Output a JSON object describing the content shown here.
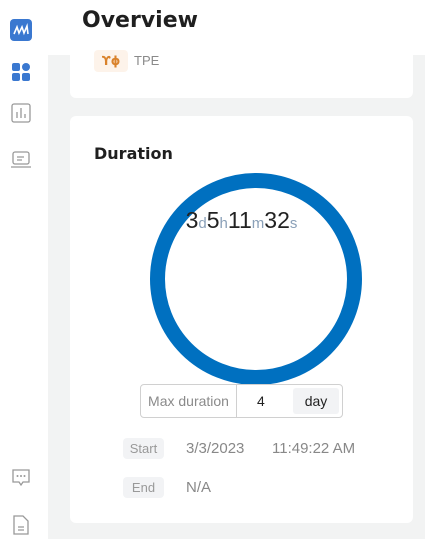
{
  "header": {
    "title": "Overview"
  },
  "sidebar": {
    "items": [
      {
        "icon": "logo-icon"
      },
      {
        "icon": "dashboard-icon"
      },
      {
        "icon": "chart-icon"
      },
      {
        "icon": "laptop-icon"
      },
      {
        "icon": "chat-icon"
      },
      {
        "icon": "document-icon"
      }
    ]
  },
  "trial": {
    "tag_icon": "tuner-icon",
    "label": "TPE"
  },
  "duration": {
    "title": "Duration",
    "days": "3",
    "d": "d",
    "hours": "5",
    "h": "h",
    "minutes": "11",
    "m": "m",
    "seconds": "32",
    "s": "s",
    "max_label": "Max duration",
    "max_value": "4",
    "max_unit": "day",
    "start_label": "Start",
    "start_date": "3/3/2023",
    "start_time": "11:49:22 AM",
    "end_label": "End",
    "end_value": "N/A"
  },
  "colors": {
    "accent": "#0070c0",
    "tag": "#d9822b"
  }
}
